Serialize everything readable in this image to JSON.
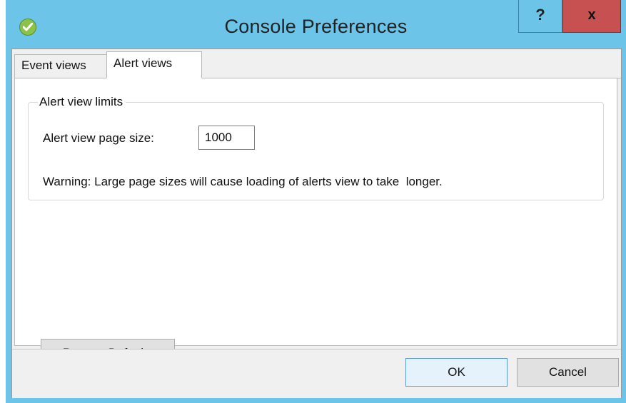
{
  "window": {
    "title": "Console Preferences",
    "icon": "check-circle-icon",
    "help_label": "?",
    "close_label": "x"
  },
  "tabs": [
    {
      "label": "Event views",
      "selected": false
    },
    {
      "label": "Alert views",
      "selected": true
    }
  ],
  "alert_views": {
    "group_title": "Alert view limits",
    "page_size_label": "Alert view page size:",
    "page_size_value": "1000",
    "warning": "Warning: Large page sizes will cause loading of alerts view to take  longer.",
    "restore_label": "Restore Defaults"
  },
  "footer": {
    "ok_label": "OK",
    "cancel_label": "Cancel"
  },
  "colors": {
    "titlebar": "#6cc4e8",
    "close_button": "#c75050",
    "app_icon": "#8bc34a"
  }
}
